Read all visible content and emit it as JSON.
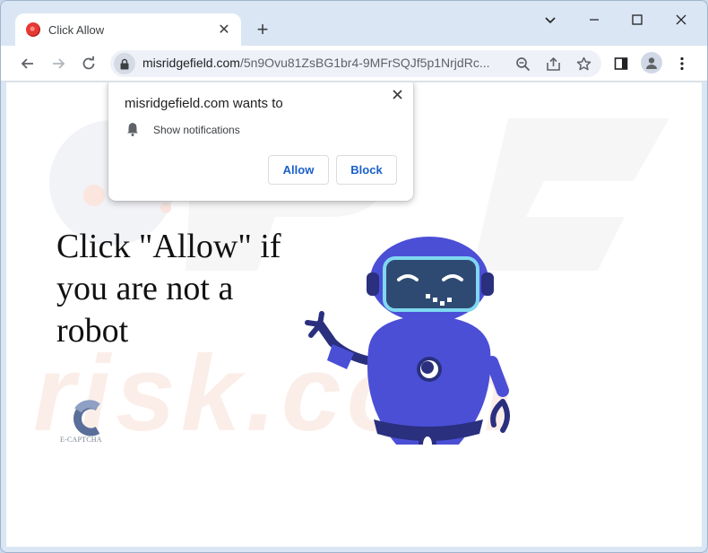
{
  "browser": {
    "tab": {
      "title": "Click Allow",
      "close_glyph": "✕"
    },
    "new_tab_glyph": "+",
    "window_controls": [
      "minimize",
      "maximize",
      "close"
    ],
    "address_bar": {
      "host": "misridgefield.com",
      "path": "/5n9Ovu81ZsBG1br4-9MFrSQJf5p1NrjdRc..."
    }
  },
  "popup": {
    "title": "misridgefield.com wants to",
    "permission_icon": "bell-icon",
    "permission": "Show notifications",
    "allow_label": "Allow",
    "block_label": "Block"
  },
  "page": {
    "headline": "Click \"Allow\" if you are not a robot",
    "captcha_label": "E-CAPTCHA",
    "watermark_text": "risk.com"
  },
  "colors": {
    "frame": "#dbe6f4",
    "accent": "#1a5fc9",
    "robot_body": "#4b4fd6",
    "robot_dark": "#2a2f7e",
    "visor": "#2e4a73",
    "visor_border": "#7fd8f0",
    "watermark": "#f5ebe6"
  }
}
